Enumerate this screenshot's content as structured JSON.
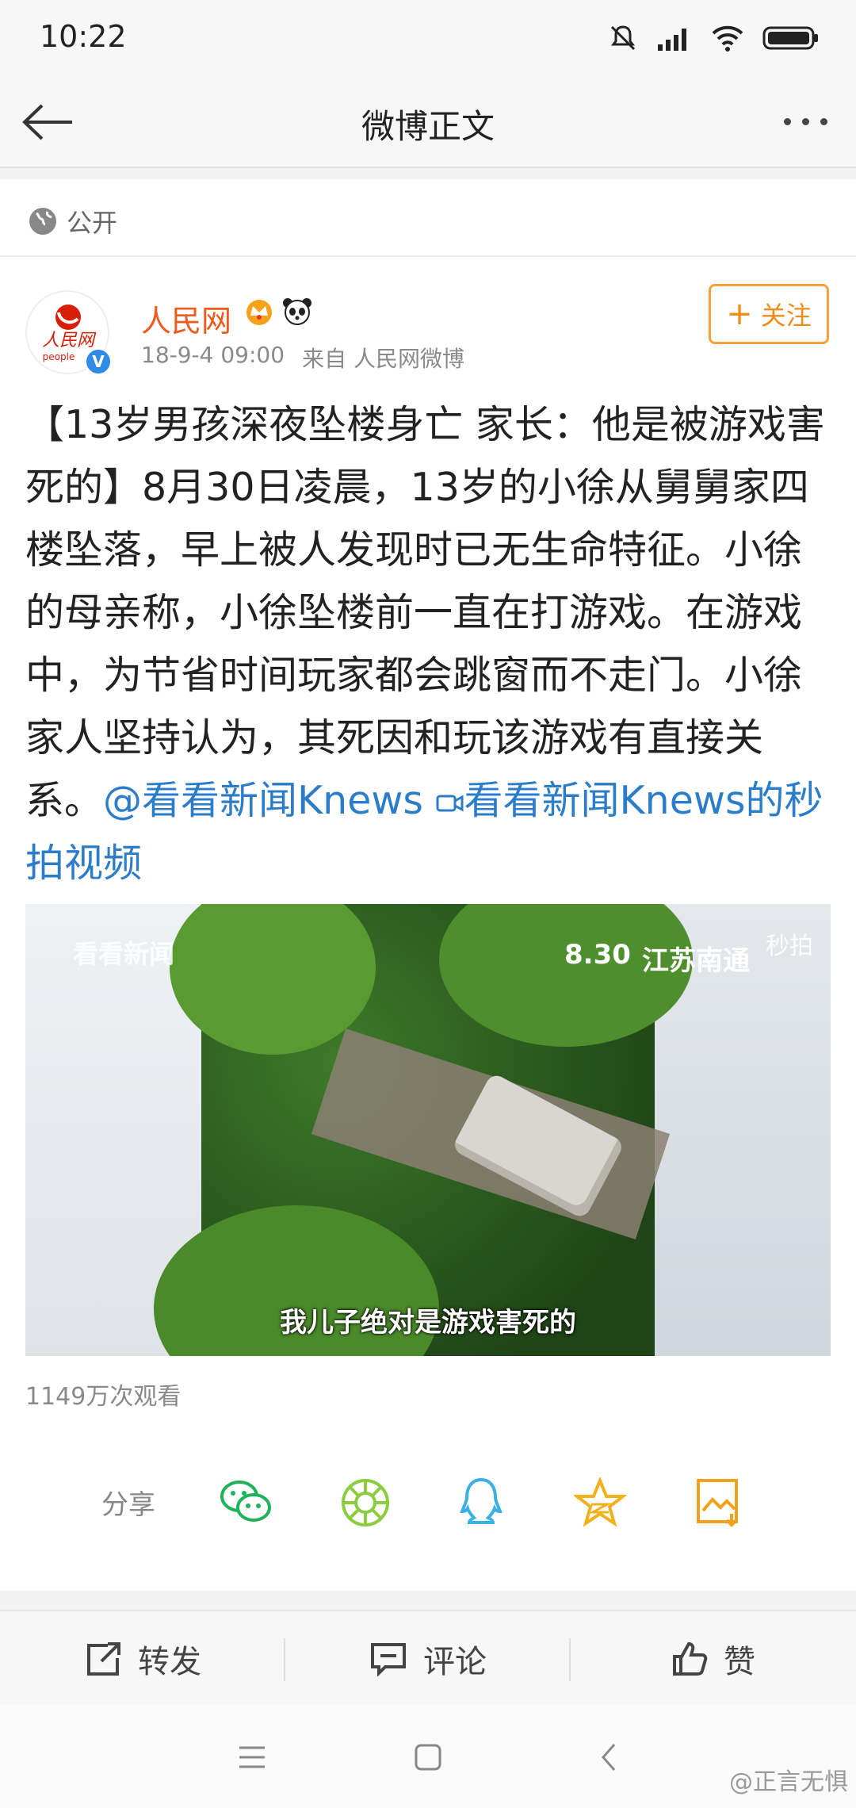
{
  "status_bar": {
    "time": "10:22"
  },
  "nav": {
    "title": "微博正文"
  },
  "post": {
    "visibility": "公开",
    "author": {
      "name": "人民网",
      "avatar_text": "人民网",
      "avatar_sub": "people"
    },
    "timestamp": "18-9-4 09:00",
    "source": "来自 人民网微博",
    "follow_label": "关注",
    "text_main": "【13岁男孩深夜坠楼身亡 家长：他是被游戏害死的】8月30日凌晨，13岁的小徐从舅舅家四楼坠落，早上被人发现时已无生命特征。小徐的母亲称，小徐坠楼前一直在打游戏。在游戏中，为节省时间玩家都会跳窗而不走门。小徐家人坚持认为，其死因和玩该游戏有直接关系。",
    "mention": "@看看新闻Knews",
    "video_link": "看看新闻Knews的秒拍视频",
    "video": {
      "watermark": "看看新闻",
      "date": "8.30",
      "region": "江苏南通",
      "caption": "我儿子绝对是游戏害死的",
      "platform_mark": "秒拍"
    },
    "view_count": "1149万次观看"
  },
  "share": {
    "label": "分享",
    "icons": [
      "wechat-icon",
      "moments-icon",
      "qq-icon",
      "qzone-icon",
      "save-image-icon"
    ]
  },
  "actions": {
    "repost": "转发",
    "comment": "评论",
    "like": "赞"
  },
  "corner_watermark": "@正言无惧",
  "colors": {
    "accent_orange": "#f05a1c",
    "link_blue": "#2c7dc9",
    "follow_border": "#f6a23b"
  }
}
